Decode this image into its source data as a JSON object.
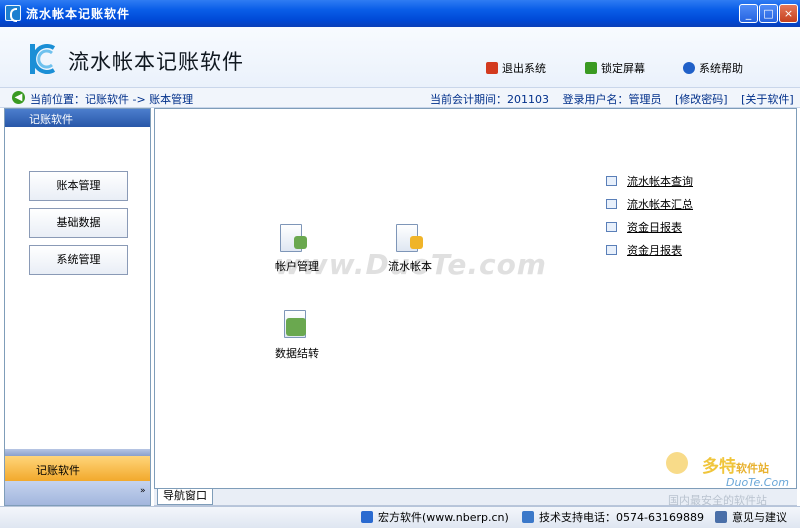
{
  "window": {
    "title": "流水帐本记账软件",
    "controls": {
      "minimize": "_",
      "maximize": "□",
      "close": "×"
    }
  },
  "header": {
    "app_title": "流水帐本记账软件",
    "actions": [
      {
        "label": "退出系统",
        "icon": "power-icon",
        "color": "#d33a1f"
      },
      {
        "label": "锁定屏幕",
        "icon": "lock-screen-icon",
        "color": "#3a9a22"
      },
      {
        "label": "系统帮助",
        "icon": "help-icon",
        "color": "#2060c8"
      }
    ]
  },
  "location": {
    "breadcrumb": "当前位置：记账软件 -> 账本管理",
    "period": "当前会计期间：201103",
    "user": "登录用户名：管理员",
    "change_password": "[修改密码]",
    "about": "[关于软件]"
  },
  "sidebar": {
    "header": "记账软件",
    "buttons": [
      "账本管理",
      "基础数据",
      "系统管理"
    ],
    "active_section": "记账软件",
    "expand_glyph": "»"
  },
  "main": {
    "tiles": [
      {
        "label": "帐户管理",
        "icon": "account-doc-icon",
        "badge_color": "#6aa84f"
      },
      {
        "label": "流水帐本",
        "icon": "ledger-doc-icon",
        "badge_color": "#f0b429"
      },
      {
        "label": "数据结转",
        "icon": "transfer-doc-icon",
        "badge_color": "#6aa84f"
      }
    ],
    "links": [
      "流水帐本查询",
      "流水帐本汇总",
      "资金日报表",
      "资金月报表"
    ],
    "watermark": "www.DuoTe.com"
  },
  "tabs": {
    "nav_tab": "导航窗口"
  },
  "statusbar": {
    "vendor": "宏方软件(www.nberp.cn)",
    "support": "技术支持电话：0574-63169889",
    "feedback": "意见与建议"
  },
  "corner_logo": {
    "brand": "多特",
    "suffix": "软件站",
    "site": "DuoTe.Com",
    "slogan": "国内最安全的软件站"
  },
  "colors": {
    "titlebar": "#0a5ee8",
    "sidebar_active": "#f2a92c",
    "link_text": "#002f8a"
  }
}
